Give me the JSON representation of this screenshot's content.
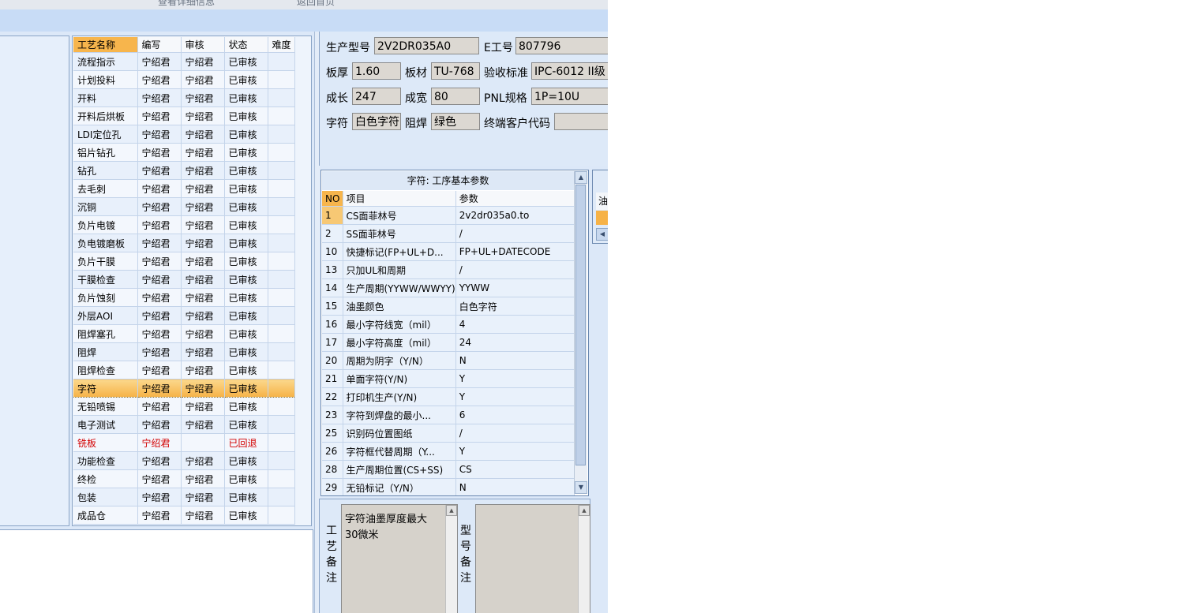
{
  "app": {
    "top_strip": [
      "查看详细信息",
      "返回首页"
    ]
  },
  "steps_table": {
    "headers": [
      "工艺名称",
      "编写",
      "审核",
      "状态",
      "难度"
    ],
    "rows": [
      {
        "name": "流程指示",
        "writer": "宁绍君",
        "reviewer": "宁绍君",
        "status": "已审核",
        "difficulty": ""
      },
      {
        "name": "计划投料",
        "writer": "宁绍君",
        "reviewer": "宁绍君",
        "status": "已审核",
        "difficulty": ""
      },
      {
        "name": "开料",
        "writer": "宁绍君",
        "reviewer": "宁绍君",
        "status": "已审核",
        "difficulty": ""
      },
      {
        "name": "开料后烘板",
        "writer": "宁绍君",
        "reviewer": "宁绍君",
        "status": "已审核",
        "difficulty": ""
      },
      {
        "name": "LDI定位孔",
        "writer": "宁绍君",
        "reviewer": "宁绍君",
        "status": "已审核",
        "difficulty": ""
      },
      {
        "name": "铝片钻孔",
        "writer": "宁绍君",
        "reviewer": "宁绍君",
        "status": "已审核",
        "difficulty": ""
      },
      {
        "name": "钻孔",
        "writer": "宁绍君",
        "reviewer": "宁绍君",
        "status": "已审核",
        "difficulty": ""
      },
      {
        "name": "去毛刺",
        "writer": "宁绍君",
        "reviewer": "宁绍君",
        "status": "已审核",
        "difficulty": ""
      },
      {
        "name": "沉铜",
        "writer": "宁绍君",
        "reviewer": "宁绍君",
        "status": "已审核",
        "difficulty": ""
      },
      {
        "name": "负片电镀",
        "writer": "宁绍君",
        "reviewer": "宁绍君",
        "status": "已审核",
        "difficulty": ""
      },
      {
        "name": "负电镀磨板",
        "writer": "宁绍君",
        "reviewer": "宁绍君",
        "status": "已审核",
        "difficulty": ""
      },
      {
        "name": "负片干膜",
        "writer": "宁绍君",
        "reviewer": "宁绍君",
        "status": "已审核",
        "difficulty": ""
      },
      {
        "name": "干膜检查",
        "writer": "宁绍君",
        "reviewer": "宁绍君",
        "status": "已审核",
        "difficulty": ""
      },
      {
        "name": "负片蚀刻",
        "writer": "宁绍君",
        "reviewer": "宁绍君",
        "status": "已审核",
        "difficulty": ""
      },
      {
        "name": "外层AOI",
        "writer": "宁绍君",
        "reviewer": "宁绍君",
        "status": "已审核",
        "difficulty": ""
      },
      {
        "name": "阻焊塞孔",
        "writer": "宁绍君",
        "reviewer": "宁绍君",
        "status": "已审核",
        "difficulty": ""
      },
      {
        "name": "阻焊",
        "writer": "宁绍君",
        "reviewer": "宁绍君",
        "status": "已审核",
        "difficulty": ""
      },
      {
        "name": "阻焊检查",
        "writer": "宁绍君",
        "reviewer": "宁绍君",
        "status": "已审核",
        "difficulty": ""
      },
      {
        "name": "字符",
        "writer": "宁绍君",
        "reviewer": "宁绍君",
        "status": "已审核",
        "difficulty": ""
      },
      {
        "name": "无铅喷锡",
        "writer": "宁绍君",
        "reviewer": "宁绍君",
        "status": "已审核",
        "difficulty": ""
      },
      {
        "name": "电子测试",
        "writer": "宁绍君",
        "reviewer": "宁绍君",
        "status": "已审核",
        "difficulty": ""
      },
      {
        "name": "铣板",
        "writer": "宁绍君",
        "reviewer": "",
        "status": "已回退",
        "difficulty": ""
      },
      {
        "name": "功能检查",
        "writer": "宁绍君",
        "reviewer": "宁绍君",
        "status": "已审核",
        "difficulty": ""
      },
      {
        "name": "终检",
        "writer": "宁绍君",
        "reviewer": "宁绍君",
        "status": "已审核",
        "difficulty": ""
      },
      {
        "name": "包装",
        "writer": "宁绍君",
        "reviewer": "宁绍君",
        "status": "已审核",
        "difficulty": ""
      },
      {
        "name": "成品仓",
        "writer": "宁绍君",
        "reviewer": "宁绍君",
        "status": "已审核",
        "difficulty": ""
      }
    ]
  },
  "info": {
    "model_label": "生产型号",
    "model_value": "2V2DR035A0",
    "eno_label": "E工号",
    "eno_value": "807796",
    "thickness_label": "板厚",
    "thickness_value": "1.60",
    "material_label": "板材",
    "material_value": "TU-768",
    "standard_label": "验收标准",
    "standard_value": "IPC-6012 II级",
    "length_label": "成长",
    "length_value": "247",
    "width_label": "成宽",
    "width_value": "80",
    "pnl_label": "PNL规格",
    "pnl_value": "1P=10U",
    "legend_label": "字符",
    "legend_value": "白色字符",
    "mask_label": "阻焊",
    "mask_value": "绿色",
    "customer_label": "终端客户代码",
    "customer_value": ""
  },
  "params": {
    "title": "字符: 工序基本参数",
    "headers": [
      "NO",
      "项目",
      "参数"
    ],
    "rows": [
      {
        "no": "1",
        "item": "CS面菲林号",
        "value": "2v2dr035a0.to"
      },
      {
        "no": "2",
        "item": "SS面菲林号",
        "value": "/"
      },
      {
        "no": "10",
        "item": "快捷标记(FP+UL+D...",
        "value": "FP+UL+DATECODE"
      },
      {
        "no": "13",
        "item": "只加UL和周期",
        "value": "/"
      },
      {
        "no": "14",
        "item": "生产周期(YYWW/WWYY)",
        "value": "YYWW"
      },
      {
        "no": "15",
        "item": "油墨颜色",
        "value": "白色字符"
      },
      {
        "no": "16",
        "item": "最小字符线宽（mil）",
        "value": "4"
      },
      {
        "no": "17",
        "item": "最小字符高度（mil）",
        "value": "24"
      },
      {
        "no": "20",
        "item": "周期为阴字（Y/N）",
        "value": "N"
      },
      {
        "no": "21",
        "item": "单面字符(Y/N)",
        "value": "Y"
      },
      {
        "no": "22",
        "item": "打印机生产(Y/N)",
        "value": "Y"
      },
      {
        "no": "23",
        "item": "字符到焊盘的最小...",
        "value": "6"
      },
      {
        "no": "25",
        "item": "识别码位置图纸",
        "value": "/"
      },
      {
        "no": "26",
        "item": "字符框代替周期（Y...",
        "value": "Y"
      },
      {
        "no": "28",
        "item": "生产周期位置(CS+SS)",
        "value": "CS"
      },
      {
        "no": "29",
        "item": "无铅标记（Y/N）",
        "value": "N"
      }
    ]
  },
  "right_panel": {
    "cell_text": "油"
  },
  "notes": {
    "process_label": [
      "工",
      "艺",
      "备",
      "注"
    ],
    "process_text": "字符油墨厚度最大30微米",
    "model_label": [
      "型",
      "号",
      "备",
      "注"
    ],
    "model_text": ""
  },
  "colors": {
    "selected_row": "#f6b247",
    "returned_status": "#d30000",
    "panel_border": "#8aa4c6",
    "background": "#dce8f8"
  }
}
